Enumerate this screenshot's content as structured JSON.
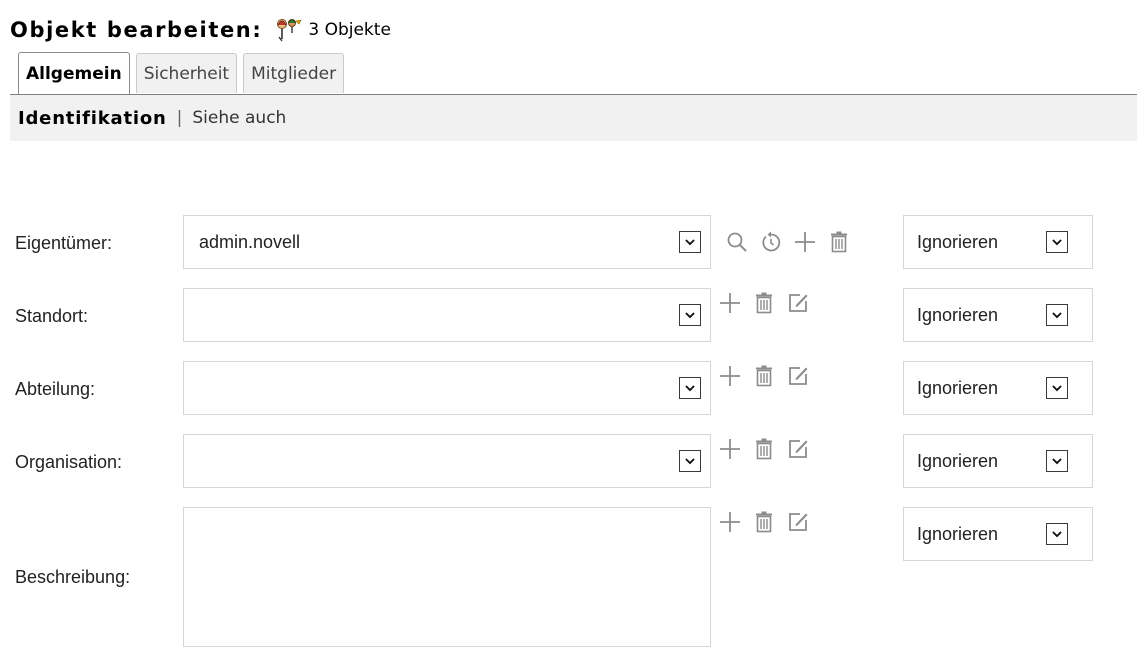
{
  "header": {
    "title": "Objekt bearbeiten:",
    "object_count": "3 Objekte",
    "object_icon": "multi-object-icon"
  },
  "tabs": [
    {
      "label": "Allgemein",
      "active": true
    },
    {
      "label": "Sicherheit",
      "active": false
    },
    {
      "label": "Mitglieder",
      "active": false
    }
  ],
  "subnav": {
    "current": "Identifikation",
    "separator": "|",
    "link": "Siehe auch"
  },
  "fields": [
    {
      "label": "Eigentümer:",
      "value": "admin.novell",
      "mode": "Ignorieren",
      "actions": [
        "search-icon",
        "history-icon",
        "add-icon",
        "delete-icon"
      ]
    },
    {
      "label": "Standort:",
      "value": "",
      "mode": "Ignorieren",
      "actions": [
        "add-icon",
        "delete-icon",
        "edit-icon"
      ]
    },
    {
      "label": "Abteilung:",
      "value": "",
      "mode": "Ignorieren",
      "actions": [
        "add-icon",
        "delete-icon",
        "edit-icon"
      ]
    },
    {
      "label": "Organisation:",
      "value": "",
      "mode": "Ignorieren",
      "actions": [
        "add-icon",
        "delete-icon",
        "edit-icon"
      ]
    },
    {
      "label": "Beschreibung:",
      "value": "",
      "mode": "Ignorieren",
      "actions": [
        "add-icon",
        "delete-icon",
        "edit-icon"
      ]
    }
  ],
  "colors": {
    "icon_gray": "#8c8c8c",
    "subnav_bg": "#f1f1f1",
    "border": "#d6d6d6"
  }
}
